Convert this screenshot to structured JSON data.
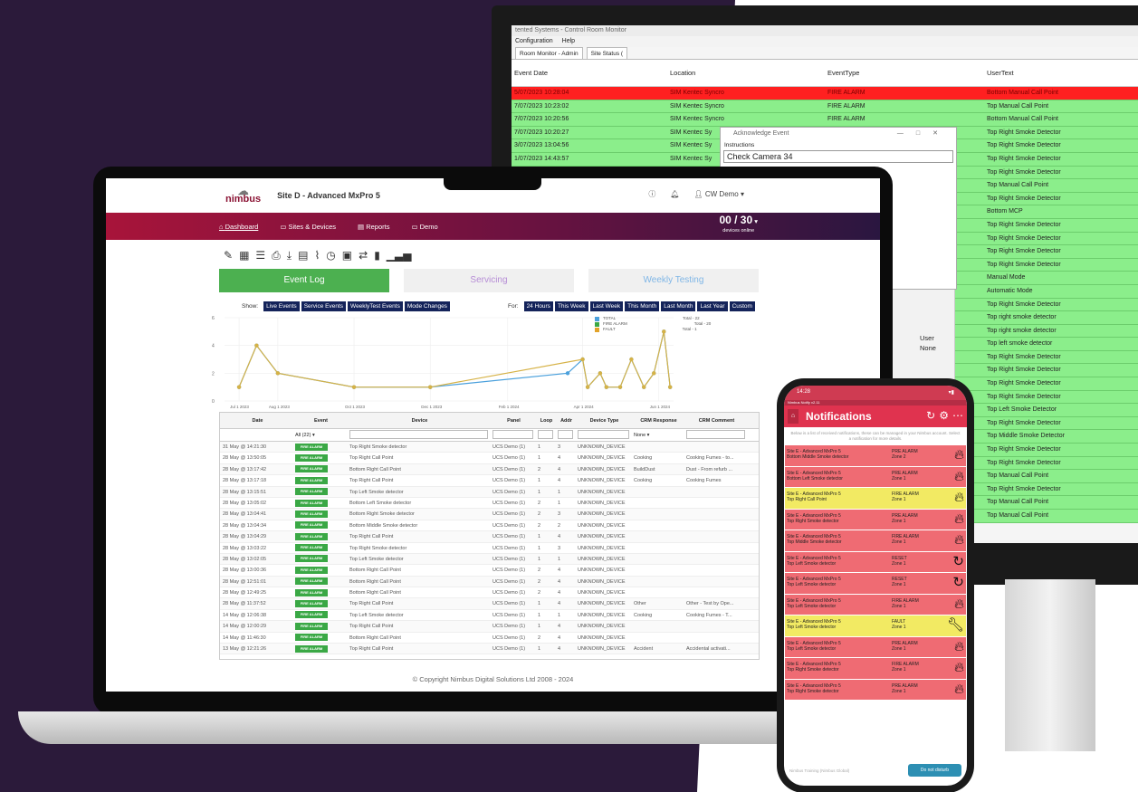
{
  "monitor": {
    "title": "tented Systems - Control Room Monitor",
    "menu": [
      "Configuration",
      "Help"
    ],
    "tabs": [
      "Room Monitor - Admin",
      "Site Status ("
    ],
    "columns": [
      "Event Date",
      "Location",
      "EventType",
      "UserText"
    ],
    "rows": [
      {
        "date": "5/07/2023 10:28:04",
        "loc": "SIM Kentec Syncro",
        "type": "FIRE ALARM",
        "text": "Bottom Manual Call Point",
        "alert": true
      },
      {
        "date": "7/07/2023 10:23:02",
        "loc": "SIM Kentec Syncro",
        "type": "FIRE ALARM",
        "text": "Top Manual Call Point"
      },
      {
        "date": "7/07/2023 10:20:56",
        "loc": "SIM Kentec Syncro",
        "type": "FIRE ALARM",
        "text": "Bottom Manual Call Point"
      },
      {
        "date": "7/07/2023 10:20:27",
        "loc": "SIM Kentec Sy",
        "type": "",
        "text": "Top Right Smoke Detector"
      },
      {
        "date": "3/07/2023 13:04:56",
        "loc": "SIM Kentec Sy",
        "type": "",
        "text": "Top Right Smoke Detector"
      },
      {
        "date": "1/07/2023 14:43:57",
        "loc": "SIM Kentec Sy",
        "type": "",
        "text": "Top Right Smoke Detector"
      },
      {
        "date": "",
        "loc": "",
        "type": "",
        "text": "Top Right Smoke Detector"
      },
      {
        "date": "",
        "loc": "",
        "type": "",
        "text": "Top Manual Call Point"
      },
      {
        "date": "",
        "loc": "",
        "type": "",
        "text": "Top Right Smoke Detector"
      },
      {
        "date": "",
        "loc": "",
        "type": "",
        "text": "Bottom MCP"
      },
      {
        "date": "",
        "loc": "",
        "type": "",
        "text": "Top Right Smoke Detector"
      },
      {
        "date": "",
        "loc": "",
        "type": "",
        "text": "Top Right Smoke Detector"
      },
      {
        "date": "",
        "loc": "",
        "type": "",
        "text": "Top Right Smoke Detector"
      },
      {
        "date": "",
        "loc": "",
        "type": "",
        "text": "Top Right Smoke Detector"
      },
      {
        "date": "",
        "loc": "",
        "type": "",
        "text": "Manual Mode"
      },
      {
        "date": "",
        "loc": "",
        "type": "",
        "text": "Automatic Mode"
      },
      {
        "date": "",
        "loc": "",
        "type": "",
        "text": "Top Right Smoke Detector"
      },
      {
        "date": "",
        "loc": "",
        "type": "",
        "text": "Top right smoke detector"
      },
      {
        "date": "",
        "loc": "",
        "type": "",
        "text": "Top right smoke detector"
      },
      {
        "date": "",
        "loc": "",
        "type": "",
        "text": "Top left smoke detector"
      },
      {
        "date": "",
        "loc": "",
        "type": "",
        "text": "Top Right Smoke Detector"
      },
      {
        "date": "",
        "loc": "",
        "type": "",
        "text": "Top Right Smoke Detector"
      },
      {
        "date": "",
        "loc": "",
        "type": "",
        "text": "Top Right Smoke Detector"
      },
      {
        "date": "",
        "loc": "",
        "type": "",
        "text": "Top Right Smoke Detector"
      },
      {
        "date": "",
        "loc": "",
        "type": "",
        "text": "Top Left Smoke Detector"
      },
      {
        "date": "",
        "loc": "",
        "type": "",
        "text": "Top Right Smoke Detector"
      },
      {
        "date": "",
        "loc": "",
        "type": "",
        "text": "Top Middle Smoke Detector"
      },
      {
        "date": "",
        "loc": "",
        "type": "",
        "text": "Top Right Smoke Detector"
      },
      {
        "date": "",
        "loc": "",
        "type": "",
        "text": "Top Right Smoke Detector"
      },
      {
        "date": "",
        "loc": "",
        "type": "",
        "text": "Top Manual Call Point"
      },
      {
        "date": "",
        "loc": "",
        "type": "",
        "text": "Top Right Smoke Detector"
      },
      {
        "date": "",
        "loc": "",
        "type": "",
        "text": "Top Manual Call Point"
      },
      {
        "date": "",
        "loc": "",
        "type": "",
        "text": "Top Manual Call Point"
      }
    ],
    "ack_dialog": {
      "title": "Acknowledge Event",
      "label": "Instructions",
      "value": "Check Camera 34"
    },
    "user_col": {
      "label": "User",
      "value": "None"
    }
  },
  "laptop": {
    "logo": "nimbus",
    "site_title": "Site D - Advanced MxPro 5",
    "user": "CW Demo",
    "nav": [
      "Dashboard",
      "Sites & Devices",
      "Reports",
      "Demo"
    ],
    "online_count": "00 / 30",
    "online_label": "devices online",
    "tabs": [
      "Event Log",
      "Servicing",
      "Weekly Testing"
    ],
    "show_label": "Show:",
    "show_buttons": [
      "Live Events",
      "Service Events",
      "WeeklyTest Events",
      "Mode Changes"
    ],
    "for_label": "For:",
    "for_buttons": [
      "24 Hours",
      "This Week",
      "Last Week",
      "This Month",
      "Last Month",
      "Last Year",
      "Custom"
    ],
    "legend": [
      {
        "name": "TOTAL",
        "value": "Total - 22",
        "color": "#4aa0dc"
      },
      {
        "name": "FIRE ALARM",
        "value": "Total - 20",
        "color": "#3aa845"
      },
      {
        "name": "FAULT",
        "value": "Total - 1",
        "color": "#e2a32a"
      }
    ],
    "table_headers": [
      "Date",
      "Event",
      "Device",
      "Panel",
      "Loop",
      "Addr",
      "Device Type",
      "CRM Response",
      "CRM Comment"
    ],
    "filter_event": "All (22)",
    "filter_crm": "None",
    "rows": [
      [
        "31 May @ 14:21:30",
        "FIRE ALARM",
        "Top Right Smoke detector",
        "UCS Demo (1)",
        "1",
        "3",
        "UNKNOWN_DEVICE",
        "",
        ""
      ],
      [
        "28 May @ 13:50:05",
        "FIRE ALARM",
        "Top Right Call Point",
        "UCS Demo (1)",
        "1",
        "4",
        "UNKNOWN_DEVICE",
        "Cooking",
        "Cooking Fumes - to..."
      ],
      [
        "28 May @ 13:17:42",
        "FIRE ALARM",
        "Bottom Right Call Point",
        "UCS Demo (1)",
        "2",
        "4",
        "UNKNOWN_DEVICE",
        "BuildDust",
        "Dust - From refurb ..."
      ],
      [
        "28 May @ 13:17:18",
        "FIRE ALARM",
        "Top Right Call Point",
        "UCS Demo (1)",
        "1",
        "4",
        "UNKNOWN_DEVICE",
        "Cooking",
        "Cooking Fumes"
      ],
      [
        "28 May @ 13:15:51",
        "FIRE ALARM",
        "Top Left Smoke detector",
        "UCS Demo (1)",
        "1",
        "1",
        "UNKNOWN_DEVICE",
        "",
        ""
      ],
      [
        "28 May @ 13:05:02",
        "FIRE ALARM",
        "Bottom Left Smoke detector",
        "UCS Demo (1)",
        "2",
        "1",
        "UNKNOWN_DEVICE",
        "",
        ""
      ],
      [
        "28 May @ 13:04:41",
        "FIRE ALARM",
        "Bottom Right Smoke detector",
        "UCS Demo (1)",
        "2",
        "3",
        "UNKNOWN_DEVICE",
        "",
        ""
      ],
      [
        "28 May @ 13:04:34",
        "FIRE ALARM",
        "Bottom Middle Smoke detector",
        "UCS Demo (1)",
        "2",
        "2",
        "UNKNOWN_DEVICE",
        "",
        ""
      ],
      [
        "28 May @ 13:04:29",
        "FIRE ALARM",
        "Top Right Call Point",
        "UCS Demo (1)",
        "1",
        "4",
        "UNKNOWN_DEVICE",
        "",
        ""
      ],
      [
        "28 May @ 13:03:22",
        "FIRE ALARM",
        "Top Right Smoke detector",
        "UCS Demo (1)",
        "1",
        "3",
        "UNKNOWN_DEVICE",
        "",
        ""
      ],
      [
        "28 May @ 13:02:05",
        "FIRE ALARM",
        "Top Left Smoke detector",
        "UCS Demo (1)",
        "1",
        "1",
        "UNKNOWN_DEVICE",
        "",
        ""
      ],
      [
        "28 May @ 13:00:36",
        "FIRE ALARM",
        "Bottom Right Call Point",
        "UCS Demo (1)",
        "2",
        "4",
        "UNKNOWN_DEVICE",
        "",
        ""
      ],
      [
        "28 May @ 12:51:01",
        "FIRE ALARM",
        "Bottom Right Call Point",
        "UCS Demo (1)",
        "2",
        "4",
        "UNKNOWN_DEVICE",
        "",
        ""
      ],
      [
        "28 May @ 12:49:25",
        "FIRE ALARM",
        "Bottom Right Call Point",
        "UCS Demo (1)",
        "2",
        "4",
        "UNKNOWN_DEVICE",
        "",
        ""
      ],
      [
        "28 May @ 11:37:52",
        "FIRE ALARM",
        "Top Right Call Point",
        "UCS Demo (1)",
        "1",
        "4",
        "UNKNOWN_DEVICE",
        "Other",
        "Other - Test by Ope..."
      ],
      [
        "14 May @ 12:06:38",
        "FIRE ALARM",
        "Top Left Smoke detector",
        "UCS Demo (1)",
        "1",
        "1",
        "UNKNOWN_DEVICE",
        "Cooking",
        "Cooking Fumes - T..."
      ],
      [
        "14 May @ 12:00:29",
        "FIRE ALARM",
        "Top Right Call Point",
        "UCS Demo (1)",
        "1",
        "4",
        "UNKNOWN_DEVICE",
        "",
        ""
      ],
      [
        "14 May @ 11:46:30",
        "FIRE ALARM",
        "Bottom Right Call Point",
        "UCS Demo (1)",
        "2",
        "4",
        "UNKNOWN_DEVICE",
        "",
        ""
      ],
      [
        "13 May @ 12:21:26",
        "FIRE ALARM",
        "Top Right Call Point",
        "UCS Demo (1)",
        "1",
        "4",
        "UNKNOWN_DEVICE",
        "Accident",
        "Accidental activati..."
      ]
    ],
    "copyright": "© Copyright Nimbus Digital Solutions Ltd 2008 - 2024"
  },
  "chart_data": {
    "type": "line",
    "x_ticks": [
      "Jul 1 2023",
      "Aug 1 2023",
      "Oct 1 2023",
      "Dec 1 2023",
      "Feb 1 2024",
      "Apr 1 2024",
      "Jun 1 2024"
    ],
    "ylim": [
      0,
      6
    ],
    "y_ticks": [
      0,
      2,
      4,
      6
    ],
    "series": [
      {
        "name": "TOTAL",
        "color": "#4aa0dc",
        "points": [
          [
            "2023-07-01",
            1
          ],
          [
            "2023-07-15",
            4
          ],
          [
            "2023-08-01",
            2
          ],
          [
            "2023-10-01",
            1
          ],
          [
            "2023-12-01",
            1
          ],
          [
            "2024-03-20",
            2
          ],
          [
            "2024-04-01",
            3
          ],
          [
            "2024-04-05",
            1
          ],
          [
            "2024-04-15",
            2
          ],
          [
            "2024-04-20",
            1
          ],
          [
            "2024-05-01",
            1
          ],
          [
            "2024-05-10",
            3
          ],
          [
            "2024-05-20",
            1
          ],
          [
            "2024-05-28",
            2
          ],
          [
            "2024-06-05",
            5
          ],
          [
            "2024-06-10",
            1
          ]
        ]
      },
      {
        "name": "FIRE ALARM",
        "color": "#d6b246",
        "points": [
          [
            "2023-07-01",
            1
          ],
          [
            "2023-07-15",
            4
          ],
          [
            "2023-08-01",
            2
          ],
          [
            "2023-10-01",
            1
          ],
          [
            "2023-12-01",
            1
          ],
          [
            "2024-04-01",
            3
          ],
          [
            "2024-04-05",
            1
          ],
          [
            "2024-04-15",
            2
          ],
          [
            "2024-04-20",
            1
          ],
          [
            "2024-05-01",
            1
          ],
          [
            "2024-05-10",
            3
          ],
          [
            "2024-05-20",
            1
          ],
          [
            "2024-05-28",
            2
          ],
          [
            "2024-06-05",
            5
          ],
          [
            "2024-06-10",
            1
          ]
        ]
      }
    ]
  },
  "phone": {
    "time": "14:28",
    "app_version": "Nimbus Notify v2.11",
    "title": "Notifications",
    "note": "Below is a list of received notifications, these can be managed in your Nimbus account. Select a notification for more details.",
    "items": [
      {
        "site": "Site E - Advanced MxPro 5",
        "device": "Bottom Middle Smoke detector",
        "event": "PRE ALARM",
        "zone": "Zone 2",
        "icon": "fire",
        "color": "red"
      },
      {
        "site": "Site E - Advanced MxPro 5",
        "device": "Bottom Left Smoke detector",
        "event": "PRE ALARM",
        "zone": "Zone 1",
        "icon": "fire",
        "color": "red"
      },
      {
        "site": "Site E - Advanced MxPro 5",
        "device": "Top Right Call Point",
        "event": "FIRE ALARM",
        "zone": "Zone 1",
        "icon": "fire",
        "color": "yellow"
      },
      {
        "site": "Site E - Advanced MxPro 5",
        "device": "Top Right Smoke detector",
        "event": "PRE ALARM",
        "zone": "Zone 1",
        "icon": "fire",
        "color": "red"
      },
      {
        "site": "Site E - Advanced MxPro 5",
        "device": "Top Middle Smoke detector",
        "event": "FIRE ALARM",
        "zone": "Zone 1",
        "icon": "fire",
        "color": "red"
      },
      {
        "site": "Site E - Advanced MxPro 5",
        "device": "Top Left Smoke detector",
        "event": "RESET",
        "zone": "Zone 1",
        "icon": "reset",
        "color": "red"
      },
      {
        "site": "Site E - Advanced MxPro 5",
        "device": "Top Left Smoke detector",
        "event": "RESET",
        "zone": "Zone 1",
        "icon": "reset",
        "color": "red"
      },
      {
        "site": "Site E - Advanced MxPro 5",
        "device": "Top Left Smoke detector",
        "event": "FIRE ALARM",
        "zone": "Zone 1",
        "icon": "fire",
        "color": "red"
      },
      {
        "site": "Site E - Advanced MxPro 5",
        "device": "Top Left Smoke detector",
        "event": "FAULT",
        "zone": "Zone 1",
        "icon": "wrench",
        "color": "yellow"
      },
      {
        "site": "Site E - Advanced MxPro 5",
        "device": "Top Left Smoke detector",
        "event": "PRE ALARM",
        "zone": "Zone 1",
        "icon": "fire",
        "color": "red"
      },
      {
        "site": "Site E - Advanced MxPro 5",
        "device": "Top Right Smoke detector",
        "event": "FIRE ALARM",
        "zone": "Zone 1",
        "icon": "fire",
        "color": "red"
      },
      {
        "site": "Site E - Advanced MxPro 5",
        "device": "Top Right Smoke detector",
        "event": "PRE ALARM",
        "zone": "Zone 1",
        "icon": "fire",
        "color": "red"
      }
    ],
    "footer_text": "Nimbus Training (Nimbus Global)",
    "dnd_label": "Do not disturb"
  }
}
